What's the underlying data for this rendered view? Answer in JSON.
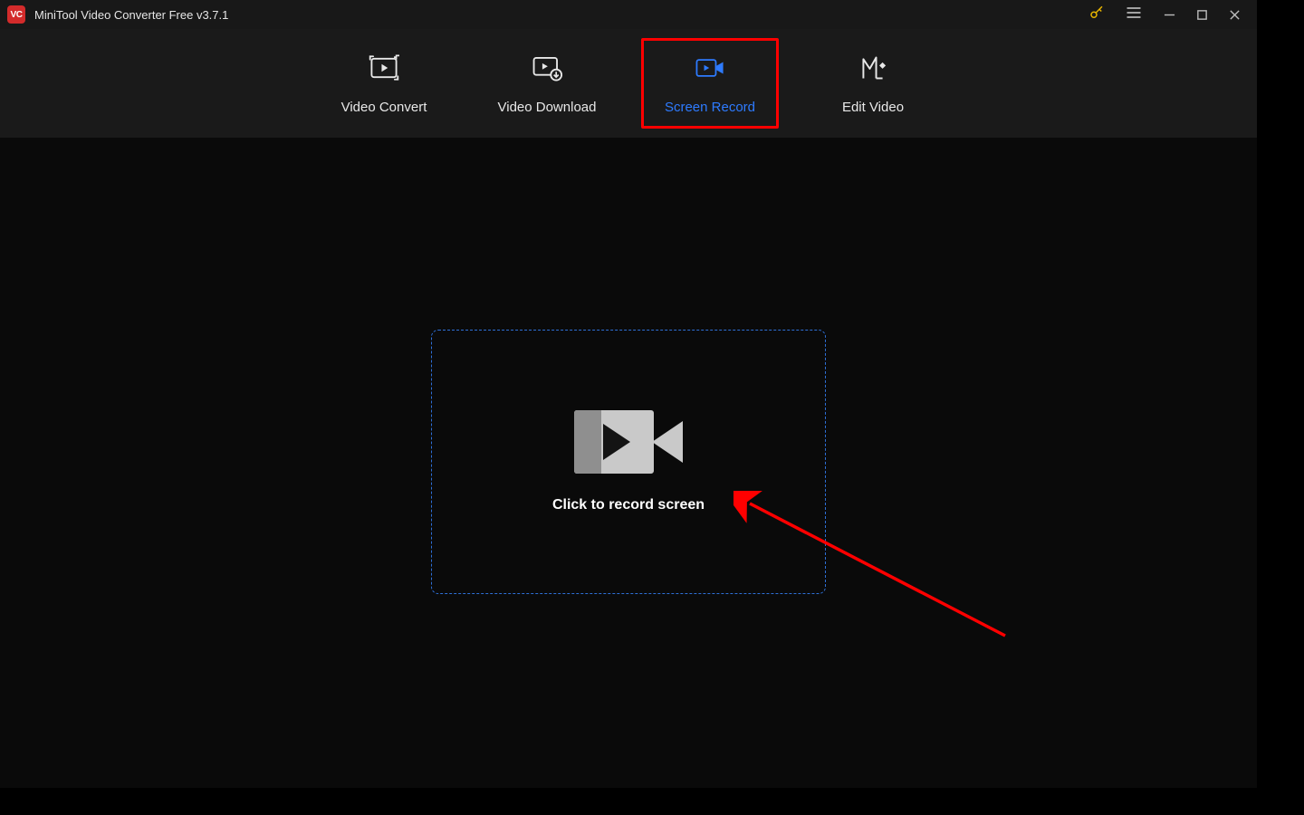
{
  "titlebar": {
    "app_abbrev": "VC",
    "title": "MiniTool Video Converter Free v3.7.1"
  },
  "tabs": [
    {
      "label": "Video Convert"
    },
    {
      "label": "Video Download"
    },
    {
      "label": "Screen Record"
    },
    {
      "label": "Edit Video"
    }
  ],
  "main": {
    "record_prompt": "Click to record screen"
  }
}
